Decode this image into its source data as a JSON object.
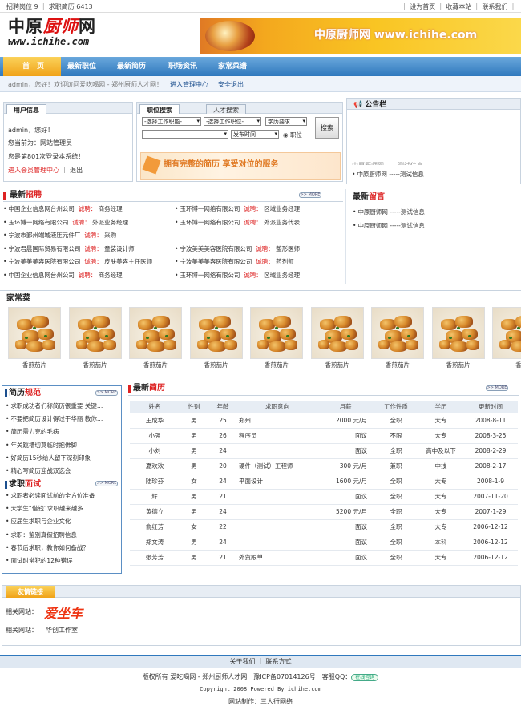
{
  "topbar": {
    "left": "招聘岗位 9 ｜ 求职简历 6413",
    "right": "｜ 设为首页 ｜ 收藏本站 ｜ 联系我们 ｜"
  },
  "header": {
    "logo_cn_a": "中原",
    "logo_cn_b": "厨师",
    "logo_cn_c": "网",
    "logo_url": "www.ichihe.com",
    "banner_text": "中原厨师网 www.ichihe.com"
  },
  "nav": {
    "items": [
      "首　页",
      "最新职位",
      "最新简历",
      "职场资讯",
      "家常菜谱"
    ]
  },
  "welcome": {
    "text": "admin，您好！欢迎访问爱吃喝网 - 郑州厨师人才网！",
    "manage": "进入管理中心",
    "logout": "安全退出"
  },
  "userinfo": {
    "tab": "用户信息",
    "hello": "admin，您好！",
    "identity": "您当前为：网站管理员",
    "login_count": "您是第801次登录本系统！",
    "member_link": "进入会员管理中心",
    "sep": "｜",
    "exit": "退出"
  },
  "search": {
    "tab_job": "职位搜索",
    "tab_talent": "人才搜索",
    "sel_job": "-选择工作职能-",
    "sel_job2": "-选择工作职位-",
    "sel_edu": "学历要求",
    "sel_time": "发布时间",
    "radio_label": "职位",
    "button": "搜索",
    "slogan": "拥有完整的简历 享受对位的服务"
  },
  "notice": {
    "title": "公告栏",
    "items": [
      "中原厨师网 -----测试信息"
    ],
    "faded": "中原厨师网 -----测试信息"
  },
  "recruit": {
    "title_a": "最新",
    "title_b": "招聘",
    "more": ">> MORE",
    "hire_word": "诚聘：",
    "rows": [
      [
        {
          "co": "中国企业信息网台州公司",
          "job": "商务经理"
        },
        {
          "co": "玉环博一网络有限公司",
          "job": "区域业务经理"
        }
      ],
      [
        {
          "co": "玉环博一网络有限公司",
          "job": "外派业务经理"
        },
        {
          "co": "玉环博一网络有限公司",
          "job": "外派业务代表"
        }
      ],
      [
        {
          "co": "宁波市鄞州端城液压元件厂",
          "job": "采购"
        },
        null
      ],
      [
        {
          "co": "宁波君晨国际贸易有限公司",
          "job": "童装设计师"
        },
        {
          "co": "宁波美美美容医院有限公司",
          "job": "整形医师"
        }
      ],
      [
        {
          "co": "宁波美美美容医院有限公司",
          "job": "皮肤美容主任医师"
        },
        {
          "co": "宁波美美美容医院有限公司",
          "job": "药剂师"
        }
      ],
      [
        {
          "co": "中国企业信息网台州公司",
          "job": "商务经理"
        },
        {
          "co": "玉环博一网络有限公司",
          "job": "区域业务经理"
        }
      ]
    ]
  },
  "message": {
    "title_a": "最新",
    "title_b": "留言",
    "items": [
      "中原厨师网 -----测试信息",
      "中原厨师网 -----测试信息"
    ]
  },
  "dishes": {
    "title": "家常菜",
    "names": [
      "香煎茄片",
      "香煎茄片",
      "香煎茄片",
      "香煎茄片",
      "香煎茄片",
      "香煎茄片",
      "香煎茄片",
      "香煎茄片",
      "香"
    ]
  },
  "resume_tips": {
    "title_a": "简历",
    "title_b": "规范",
    "more": ">> MORE",
    "items": [
      "求职成功者们称简历很重要 关键…",
      "不要把简历设计得过于华丽 教你…",
      "简历需力克的毛病",
      "年关跳槽切莫临时抱佛脚",
      "好简历15秒给人留下深刻印象",
      "精心写简历迎战双选会"
    ]
  },
  "interview_tips": {
    "title_a": "求职",
    "title_b": "面试",
    "more": ">> MORE",
    "items": [
      "求职者必读面试前的全方位准备",
      "大学生“借钱”求职越来越多",
      "应届生求职与企业文化",
      "求职：鉴别真假招聘信息",
      "春节后求职，教你如何备战？",
      "面试时常犯的12种错误"
    ]
  },
  "resumes": {
    "title_a": "最新",
    "title_b": "简历",
    "more": ">> MORE",
    "headers": [
      "姓名",
      "性别",
      "年龄",
      "求职意向",
      "月薪",
      "工作性质",
      "学历",
      "更新时间"
    ],
    "rows": [
      [
        "王成华",
        "男",
        "25",
        "郑州",
        "2000 元/月",
        "全职",
        "大专",
        "2008-8-11"
      ],
      [
        "小强",
        "男",
        "26",
        "程序员",
        "面议",
        "不限",
        "大专",
        "2008-3-25"
      ],
      [
        "小刘",
        "男",
        "24",
        "",
        "面议",
        "全职",
        "高中及以下",
        "2008-2-29"
      ],
      [
        "夏欢欢",
        "男",
        "20",
        "硬件（测试）工程师",
        "300 元/月",
        "兼职",
        "中技",
        "2008-2-17"
      ],
      [
        "陆珍芬",
        "女",
        "24",
        "平面设计",
        "1600 元/月",
        "全职",
        "大专",
        "2008-1-9"
      ],
      [
        "辉",
        "男",
        "21",
        "",
        "面议",
        "全职",
        "大专",
        "2007-11-20"
      ],
      [
        "黄德立",
        "男",
        "24",
        "",
        "5200 元/月",
        "全职",
        "大专",
        "2007-1-29"
      ],
      [
        "俞红芳",
        "女",
        "22",
        "",
        "面议",
        "全职",
        "大专",
        "2006-12-12"
      ],
      [
        "郑文涛",
        "男",
        "24",
        "",
        "面议",
        "全职",
        "本科",
        "2006-12-12"
      ],
      [
        "张芳芳",
        "男",
        "21",
        "外贸跟单",
        "面议",
        "全职",
        "大专",
        "2006-12-12"
      ]
    ]
  },
  "friends": {
    "tab": "友情链接",
    "label1": "相关网站：",
    "logo_text": "爱坐车",
    "label2": "相关网站：",
    "link2": "华创工作室"
  },
  "footer": {
    "nav": "关于我们 ｜ 联系方式",
    "line1": "版权所有 爱吃喝网 - 郑州厨师人才网　豫ICP备07014126号　客服QQ：",
    "qq": "在线咨询",
    "line2": "Copyright 2008 Powered By ichihe.com",
    "line3": "网站制作：三人行网络"
  },
  "colors": {
    "nav": "#2f78bd",
    "accent_red": "#d22",
    "home_tab": "#f0a218"
  }
}
